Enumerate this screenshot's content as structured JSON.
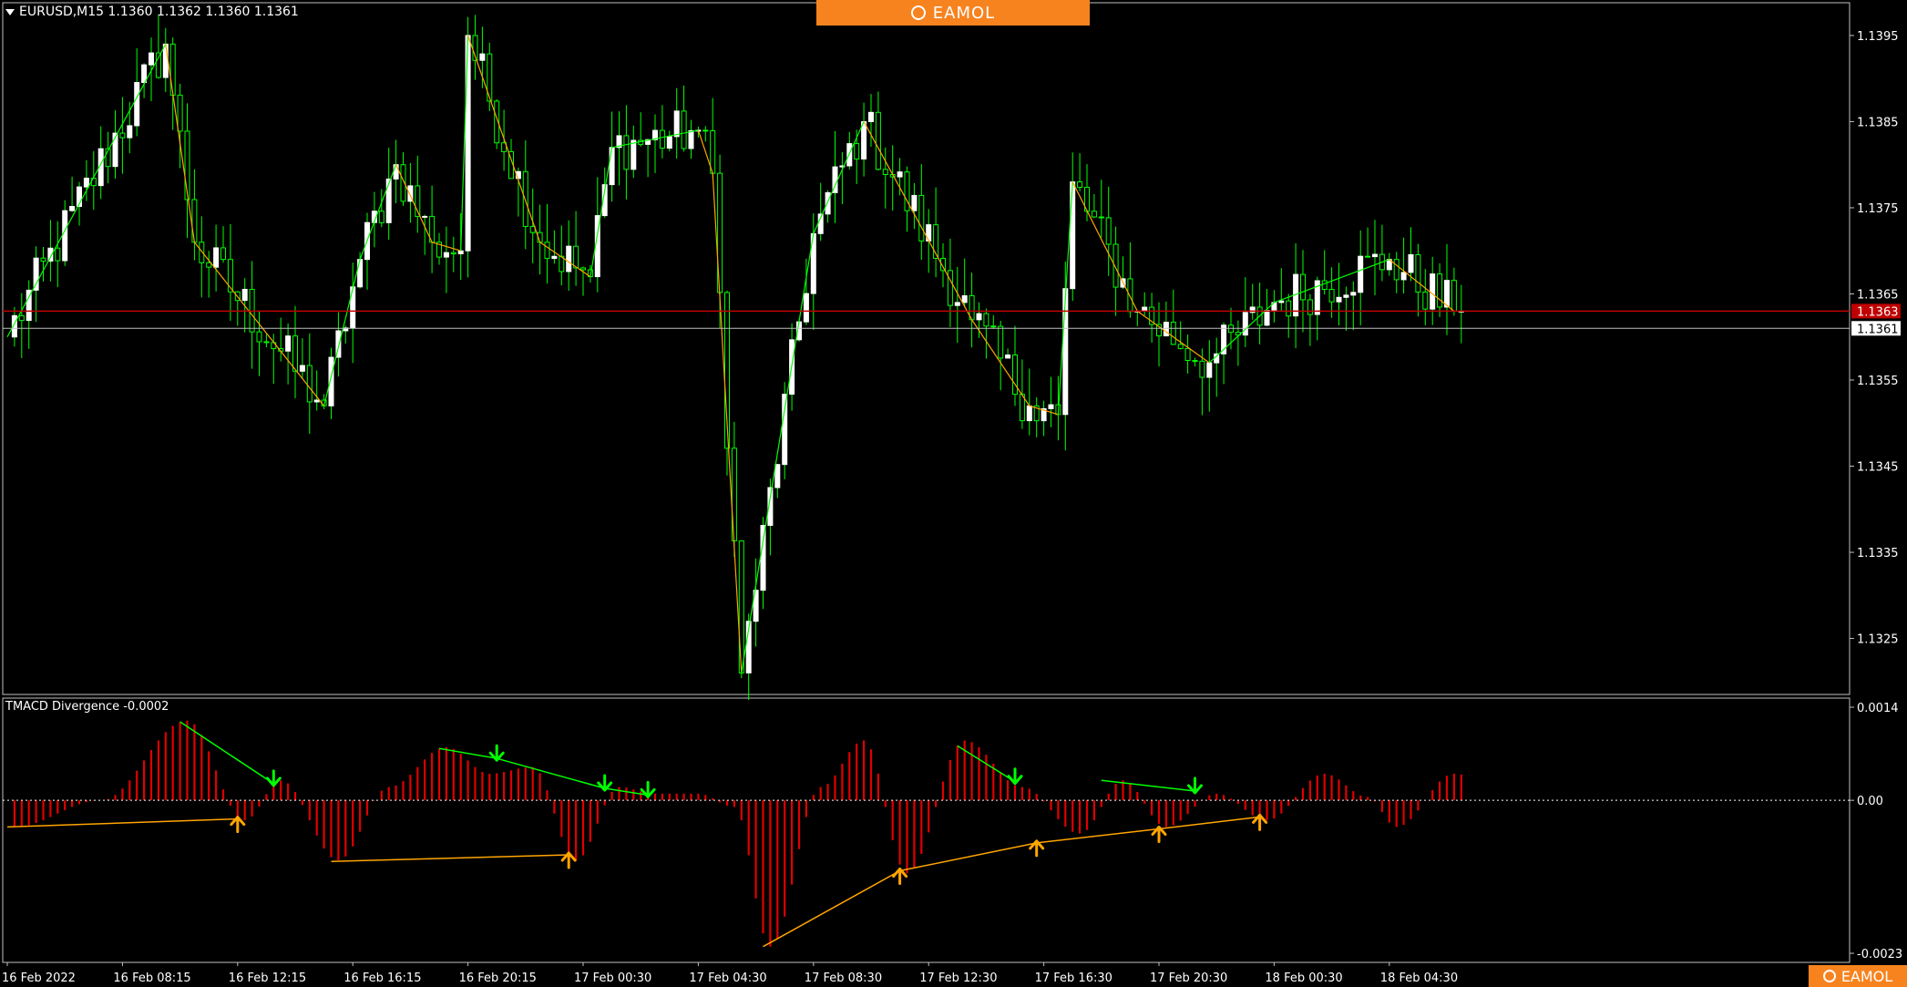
{
  "header": {
    "symbol_info": "EURUSD,M15  1.1360 1.1362 1.1360 1.1361",
    "menu_icon": "triangle-down-icon"
  },
  "brand": {
    "name": "EAMOL",
    "icon": "robot-face-icon",
    "color": "#f7831f"
  },
  "indicator": {
    "label": "TMACD Divergence -0.0002"
  },
  "colors": {
    "background": "#000000",
    "frame": "#c0c0c0",
    "bull_candle": "#ffffff",
    "bull_wick": "#00ff00",
    "bear_candle": "#000000",
    "bear_outline": "#00ff00",
    "zigzag_up": "#00ff00",
    "zigzag_down": "#ffa500",
    "histogram": "#e00000",
    "divergence_bear": "#00ff00",
    "divergence_bull": "#ffa500",
    "bid_line": "#c0c0c0",
    "ask_line": "#c00000",
    "ask_tag": "#c00000"
  },
  "chart_data": [
    {
      "type": "candlestick",
      "title": "",
      "symbol": "EURUSD",
      "timeframe": "M15",
      "y_ticks": [
        "1.1395",
        "1.1385",
        "1.1375",
        "1.1365",
        "1.1355",
        "1.1345",
        "1.1335",
        "1.1325"
      ],
      "ylim": [
        1.13185,
        1.13988
      ],
      "x_ticks": [
        "16 Feb 2022",
        "16 Feb 08:15",
        "16 Feb 12:15",
        "16 Feb 16:15",
        "16 Feb 20:15",
        "17 Feb 00:30",
        "17 Feb 04:30",
        "17 Feb 08:30",
        "17 Feb 12:30",
        "17 Feb 16:30",
        "17 Feb 20:30",
        "18 Feb 00:30",
        "18 Feb 04:30"
      ],
      "bid_price": "1.1361",
      "ask_price": "1.1363",
      "grid": false,
      "zigzag_points": [
        [
          0,
          1.136
        ],
        [
          22,
          1.1394
        ],
        [
          26,
          1.1371
        ],
        [
          44,
          1.1352
        ],
        [
          49,
          1.1369
        ],
        [
          54,
          1.138
        ],
        [
          59,
          1.1371
        ],
        [
          63,
          1.137
        ],
        [
          64,
          1.1395
        ],
        [
          74,
          1.1371
        ],
        [
          81,
          1.1367
        ],
        [
          84,
          1.1382
        ],
        [
          96,
          1.1384
        ],
        [
          98,
          1.1379
        ],
        [
          102,
          1.1321
        ],
        [
          112,
          1.1372
        ],
        [
          119,
          1.1385
        ],
        [
          134,
          1.1362
        ],
        [
          142,
          1.1352
        ],
        [
          146,
          1.1351
        ],
        [
          148,
          1.1378
        ],
        [
          157,
          1.1363
        ],
        [
          167,
          1.1357
        ],
        [
          176,
          1.1364
        ],
        [
          192,
          1.1369
        ],
        [
          201,
          1.1363
        ]
      ]
    },
    {
      "type": "histogram",
      "title": "TMACD Divergence -0.0002",
      "y_ticks": [
        "0.0014",
        "0.00",
        "-0.0023"
      ],
      "ylim": [
        -0.0023,
        0.0014
      ],
      "zero_line": "dotted",
      "grid": false,
      "divergence_bear_arrows": [
        37,
        68,
        83,
        89,
        140,
        165
      ],
      "divergence_bull_arrows": [
        32,
        78,
        124,
        143,
        160,
        174
      ],
      "divergence_bear_lines": [
        [
          [
            24,
            0.00118
          ],
          [
            37,
            0.00025
          ]
        ],
        [
          [
            60,
            0.00078
          ],
          [
            68,
            0.00063
          ],
          [
            83,
            0.00018
          ],
          [
            89,
            8e-05
          ]
        ],
        [
          [
            132,
            0.00082
          ],
          [
            140,
            0.00028
          ]
        ],
        [
          [
            152,
            0.0003
          ],
          [
            165,
            0.00014
          ]
        ]
      ],
      "divergence_bull_lines": [
        [
          [
            0,
            -0.0004
          ],
          [
            32,
            -0.00028
          ]
        ],
        [
          [
            45,
            -0.00092
          ],
          [
            78,
            -0.00082
          ]
        ],
        [
          [
            105,
            -0.0022
          ],
          [
            124,
            -0.00106
          ],
          [
            143,
            -0.00064
          ],
          [
            160,
            -0.00043
          ],
          [
            174,
            -0.00025
          ]
        ]
      ]
    }
  ]
}
